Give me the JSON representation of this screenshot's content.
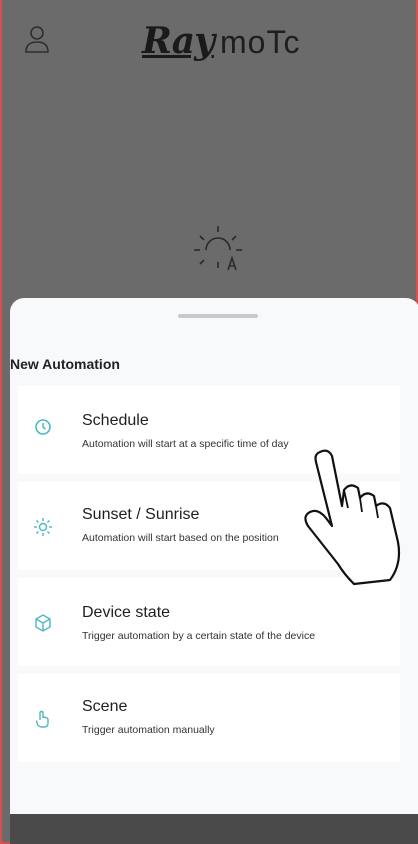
{
  "header": {
    "logo_text_ray": "Ray",
    "logo_text_mote": "moTc"
  },
  "sheet": {
    "title": "New Automation",
    "options": [
      {
        "title": "Schedule",
        "subtitle": "Automation will start at a specific time of day",
        "icon": "clock-icon"
      },
      {
        "title": "Sunset / Sunrise",
        "subtitle": "Automation will start based on the position",
        "icon": "sun-icon"
      },
      {
        "title": "Device state",
        "subtitle": "Trigger automation by a certain state of the device",
        "icon": "cube-icon"
      },
      {
        "title": "Scene",
        "subtitle": "Trigger automation manually",
        "icon": "hand-tap-icon"
      }
    ]
  },
  "colors": {
    "accent": "#e25552",
    "icon_teal": "#4fb7c2",
    "overlay": "#6b6b6b",
    "sheet_bg": "#f7f9fa"
  }
}
